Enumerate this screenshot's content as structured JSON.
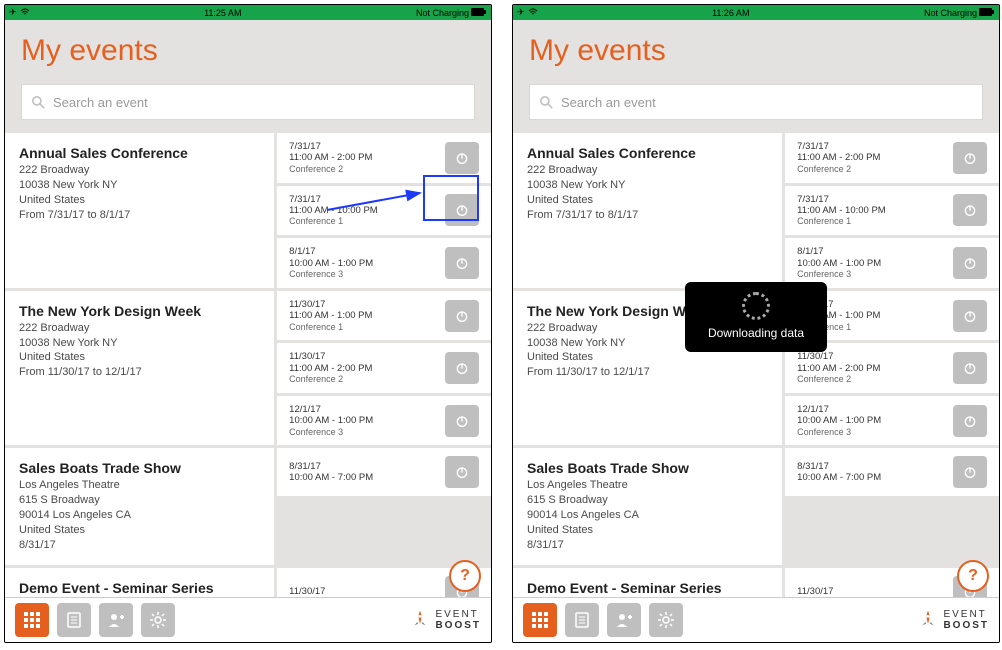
{
  "left": {
    "statusbar": {
      "time": "11:25 AM",
      "charge": "Not Charging"
    },
    "title": "My events",
    "search_placeholder": "Search an event",
    "events": [
      {
        "name": "Annual Sales Conference",
        "addr1": "222 Broadway",
        "addr2": "10038 New York NY",
        "country": "United States",
        "range": "From 7/31/17 to 8/1/17",
        "sessions": [
          {
            "date": "7/31/17",
            "time": "11:00 AM - 2:00 PM",
            "room": "Conference 2",
            "hl": true
          },
          {
            "date": "7/31/17",
            "time": "11:00 AM - 10:00 PM",
            "room": "Conference 1"
          },
          {
            "date": "8/1/17",
            "time": "10:00 AM - 1:00 PM",
            "room": "Conference 3"
          }
        ]
      },
      {
        "name": "The New York Design Week",
        "addr1": "222 Broadway",
        "addr2": "10038 New York NY",
        "country": "United States",
        "range": "From 11/30/17 to 12/1/17",
        "sessions": [
          {
            "date": "11/30/17",
            "time": "11:00 AM - 1:00 PM",
            "room": "Conference 1"
          },
          {
            "date": "11/30/17",
            "time": "11:00 AM - 2:00 PM",
            "room": "Conference 2"
          },
          {
            "date": "12/1/17",
            "time": "10:00 AM - 1:00 PM",
            "room": "Conference 3"
          }
        ]
      },
      {
        "name": "Sales Boats Trade Show",
        "addr1": "Los Angeles Theatre",
        "addr2": "615 S Broadway",
        "addr3": "90014 Los Angeles CA",
        "country": "United States",
        "range": "8/31/17",
        "sessions": [
          {
            "date": "8/31/17",
            "time": "10:00 AM - 7:00 PM",
            "room": ""
          }
        ]
      },
      {
        "name": "Demo Event - Seminar Series",
        "sessions": [
          {
            "date": "11/30/17",
            "time": "",
            "room": ""
          }
        ]
      }
    ],
    "brand1": "EVENT",
    "brand2": "BOOST",
    "help": "?"
  },
  "right": {
    "statusbar": {
      "time": "11:26 AM",
      "charge": "Not Charging"
    },
    "title": "My events",
    "search_placeholder": "Search an event",
    "overlay_text": "Downloading data",
    "events": [
      {
        "name": "Annual Sales Conference",
        "addr1": "222 Broadway",
        "addr2": "10038 New York NY",
        "country": "United States",
        "range": "From 7/31/17 to 8/1/17",
        "sessions": [
          {
            "date": "7/31/17",
            "time": "11:00 AM - 2:00 PM",
            "room": "Conference 2"
          },
          {
            "date": "7/31/17",
            "time": "11:00 AM - 10:00 PM",
            "room": "Conference 1"
          },
          {
            "date": "8/1/17",
            "time": "10:00 AM - 1:00 PM",
            "room": "Conference 3"
          }
        ]
      },
      {
        "name": "The New York Design Week",
        "addr1": "222 Broadway",
        "addr2": "10038 New York NY",
        "country": "United States",
        "range": "From 11/30/17 to 12/1/17",
        "sessions": [
          {
            "date": "11/30/17",
            "time": "11:00 AM - 1:00 PM",
            "room": "Conference 1"
          },
          {
            "date": "11/30/17",
            "time": "11:00 AM - 2:00 PM",
            "room": "Conference 2"
          },
          {
            "date": "12/1/17",
            "time": "10:00 AM - 1:00 PM",
            "room": "Conference 3"
          }
        ]
      },
      {
        "name": "Sales Boats Trade Show",
        "addr1": "Los Angeles Theatre",
        "addr2": "615 S Broadway",
        "addr3": "90014 Los Angeles CA",
        "country": "United States",
        "range": "8/31/17",
        "sessions": [
          {
            "date": "8/31/17",
            "time": "10:00 AM - 7:00 PM",
            "room": ""
          }
        ]
      },
      {
        "name": "Demo Event - Seminar Series",
        "sessions": [
          {
            "date": "11/30/17",
            "time": "",
            "room": ""
          }
        ]
      }
    ],
    "brand1": "EVENT",
    "brand2": "BOOST",
    "help": "?"
  }
}
